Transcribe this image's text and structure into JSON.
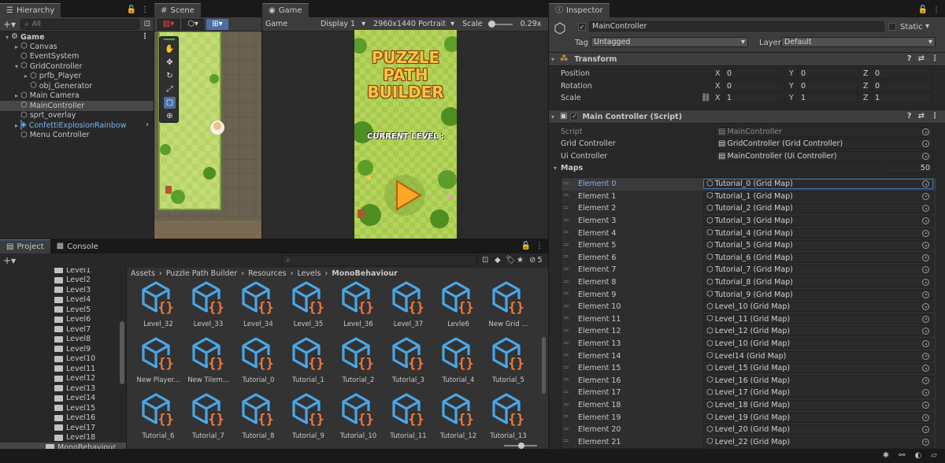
{
  "hierarchy": {
    "tab": "Hierarchy",
    "search_placeholder": "All",
    "root": "Game",
    "items": [
      {
        "label": "Canvas",
        "indent": 1,
        "arrow": "▸"
      },
      {
        "label": "EventSystem",
        "indent": 1,
        "arrow": ""
      },
      {
        "label": "GridController",
        "indent": 1,
        "arrow": "▾"
      },
      {
        "label": "prfb_Player",
        "indent": 2,
        "arrow": "▸"
      },
      {
        "label": "obj_Generator",
        "indent": 2,
        "arrow": ""
      },
      {
        "label": "Main Camera",
        "indent": 1,
        "arrow": "▸"
      },
      {
        "label": "MainController",
        "indent": 1,
        "arrow": ""
      },
      {
        "label": "sprt_overlay",
        "indent": 1,
        "arrow": ""
      },
      {
        "label": "ConfettiExplosionRainbow",
        "indent": 1,
        "arrow": "▸"
      },
      {
        "label": "Menu Controller",
        "indent": 1,
        "arrow": ""
      }
    ]
  },
  "scene": {
    "tab": "Scene"
  },
  "game": {
    "tab": "Game",
    "display": "Game",
    "display2": "Display 1",
    "resolution": "2960x1440 Portrait",
    "scale_label": "Scale",
    "scale_value": "0.29x",
    "title_line1": "PUZZLE",
    "title_line2": "PATH",
    "title_line3": "BUILDER",
    "current_level": "CURRENT LEVEL :"
  },
  "project": {
    "tab1": "Project",
    "tab2": "Console",
    "hidden_count": "5",
    "breadcrumb": [
      "Assets",
      "Puzzle Path Builder",
      "Resources",
      "Levels",
      "MonoBehaviour"
    ],
    "folders": [
      "Level1",
      "Level2",
      "Level3",
      "Level4",
      "Level5",
      "Level6",
      "Level7",
      "Level8",
      "Level9",
      "Level10",
      "Level11",
      "Level12",
      "Level13",
      "Level14",
      "Level15",
      "Level16",
      "Level17",
      "Level18",
      "MonoBehaviour"
    ],
    "assets": [
      "Level_32",
      "Level_33",
      "Level_34",
      "Level_35",
      "Level_36",
      "Level_37",
      "Levle6",
      "New Grid ...",
      "New Player...",
      "New Tilem...",
      "Tutorial_0",
      "Tutorial_1",
      "Tutorial_2",
      "Tutorial_3",
      "Tutorial_4",
      "Tutorial_5",
      "Tutorial_6",
      "Tutorial_7",
      "Tutorial_8",
      "Tutorial_9",
      "Tutorial_10",
      "Tutorial_11",
      "Tutorial_12",
      "Tutorial_13"
    ]
  },
  "inspector": {
    "tab": "Inspector",
    "object_name": "MainController",
    "static_label": "Static",
    "tag_label": "Tag",
    "tag_value": "Untagged",
    "layer_label": "Layer",
    "layer_value": "Default",
    "transform": {
      "title": "Transform",
      "position": {
        "label": "Position",
        "x": "0",
        "y": "0",
        "z": "0"
      },
      "rotation": {
        "label": "Rotation",
        "x": "0",
        "y": "0",
        "z": "0"
      },
      "scale": {
        "label": "Scale",
        "x": "1",
        "y": "1",
        "z": "1"
      }
    },
    "script": {
      "title": "Main Controller (Script)",
      "script_label": "Script",
      "script_value": "MainController",
      "grid_label": "Grid Controller",
      "grid_value": "GridController (Grid Controller)",
      "ui_label": "Ui Controller",
      "ui_value": "MainController (Ui Controller)",
      "maps_label": "Maps",
      "maps_count": "50",
      "elements": [
        {
          "name": "Element 0",
          "value": "Tutorial_0 (Grid Map)"
        },
        {
          "name": "Element 1",
          "value": "Tutorial_1 (Grid Map)"
        },
        {
          "name": "Element 2",
          "value": "Tutorial_2 (Grid Map)"
        },
        {
          "name": "Element 3",
          "value": "Tutorial_3 (Grid Map)"
        },
        {
          "name": "Element 4",
          "value": "Tutorial_4 (Grid Map)"
        },
        {
          "name": "Element 5",
          "value": "Tutorial_5 (Grid Map)"
        },
        {
          "name": "Element 6",
          "value": "Tutorial_6 (Grid Map)"
        },
        {
          "name": "Element 7",
          "value": "Tutorial_7 (Grid Map)"
        },
        {
          "name": "Element 8",
          "value": "Tutorial_8 (Grid Map)"
        },
        {
          "name": "Element 9",
          "value": "Tutorial_9 (Grid Map)"
        },
        {
          "name": "Element 10",
          "value": "Level_10 (Grid Map)"
        },
        {
          "name": "Element 11",
          "value": "Level_11 (Grid Map)"
        },
        {
          "name": "Element 12",
          "value": "Level_12 (Grid Map)"
        },
        {
          "name": "Element 13",
          "value": "Level_10 (Grid Map)"
        },
        {
          "name": "Element 14",
          "value": "Level14 (Grid Map)"
        },
        {
          "name": "Element 15",
          "value": "Level_15 (Grid Map)"
        },
        {
          "name": "Element 16",
          "value": "Level_16 (Grid Map)"
        },
        {
          "name": "Element 17",
          "value": "Level_17 (Grid Map)"
        },
        {
          "name": "Element 18",
          "value": "Level_18 (Grid Map)"
        },
        {
          "name": "Element 19",
          "value": "Level_19 (Grid Map)"
        },
        {
          "name": "Element 20",
          "value": "Level_20 (Grid Map)"
        },
        {
          "name": "Element 21",
          "value": "Level_22 (Grid Map)"
        }
      ]
    }
  },
  "colors": {
    "accent": "#3a79bb",
    "selected_text": "#7fb0ec",
    "cube_blue": "#4aa6e6",
    "brace_orange": "#f07a3c"
  }
}
